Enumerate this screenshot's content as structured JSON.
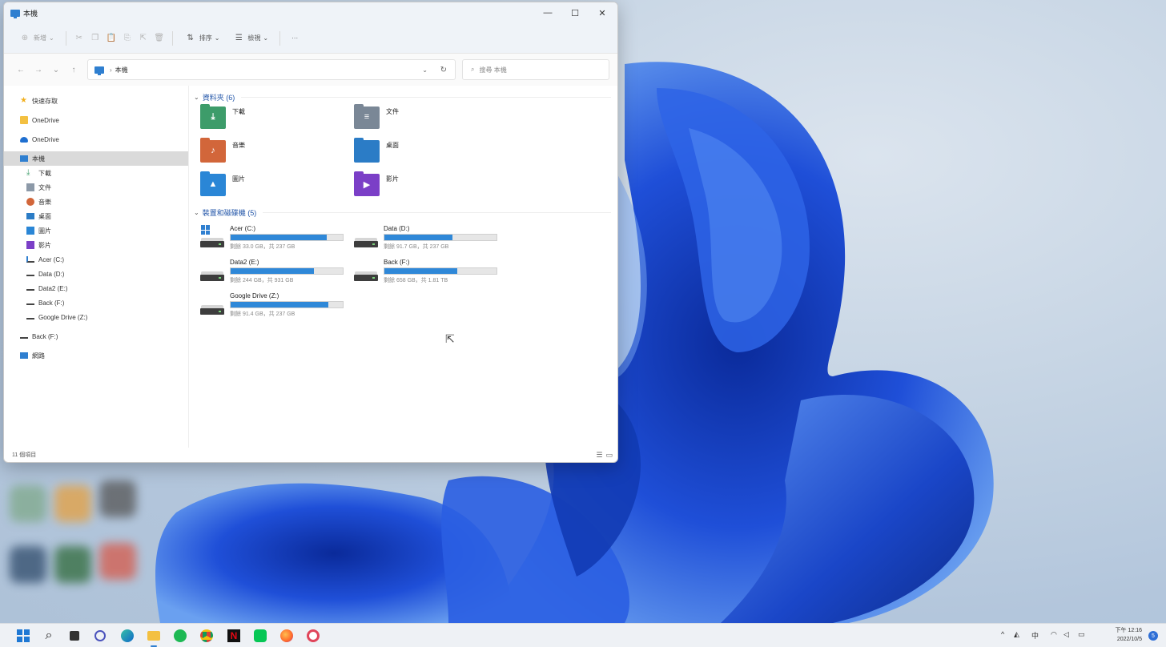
{
  "window": {
    "title": "本機",
    "controls": {
      "minimize": "—",
      "maximize": "☐",
      "close": "✕"
    }
  },
  "toolbar": {
    "new_label": "新增",
    "sort_label": "排序",
    "view_label": "檢視",
    "more_label": "···"
  },
  "address": {
    "crumb": "本機",
    "search_placeholder": "搜尋 本機"
  },
  "nav": {
    "quick_access": "快速存取",
    "onedrive_1": "OneDrive",
    "onedrive_2": "OneDrive",
    "this_pc": "本機",
    "downloads": "下載",
    "documents": "文件",
    "music": "音樂",
    "desktop": "桌面",
    "pictures": "圖片",
    "videos": "影片",
    "acer": "Acer (C:)",
    "data": "Data (D:)",
    "data2": "Data2 (E:)",
    "back": "Back (F:)",
    "gdrive": "Google Drive (Z:)",
    "back_2": "Back (F:)",
    "network": "網路"
  },
  "folders_group": {
    "title": "資料夾 (6)",
    "items": [
      {
        "label": "下載",
        "color": "#3d9c6a"
      },
      {
        "label": "文件",
        "color": "#7a8796"
      },
      {
        "label": "音樂",
        "color": "#d2663a"
      },
      {
        "label": "桌面",
        "color": "#2b7cc6"
      },
      {
        "label": "圖片",
        "color": "#2a86d6"
      },
      {
        "label": "影片",
        "color": "#7b3fc7"
      }
    ]
  },
  "drives_group": {
    "title": "裝置和磁碟機 (5)",
    "items": [
      {
        "name": "Acer (C:)",
        "space": "剩餘 33.0 GB，共 237 GB",
        "used": 0.86
      },
      {
        "name": "Data (D:)",
        "space": "剩餘 91.7 GB，共 237 GB",
        "used": 0.61
      },
      {
        "name": "Data2 (E:)",
        "space": "剩餘 244 GB，共 931 GB",
        "used": 0.74
      },
      {
        "name": "Back (F:)",
        "space": "剩餘 658 GB，共 1.81 TB",
        "used": 0.65
      },
      {
        "name": "Google Drive (Z:)",
        "space": "剩餘 91.4 GB，共 237 GB",
        "used": 0.87
      }
    ]
  },
  "status": {
    "item_count": "11 個項目"
  },
  "taskbar": {
    "tray": {
      "ime": "中",
      "chevron": "^"
    },
    "clock_time": "下午 12:16",
    "clock_date": "2022/10/5",
    "notification_count": "5"
  },
  "colors": {
    "accent": "#2f7fd0",
    "drive_fill": "#2f88d8",
    "bloom": "#1f4fd8"
  }
}
